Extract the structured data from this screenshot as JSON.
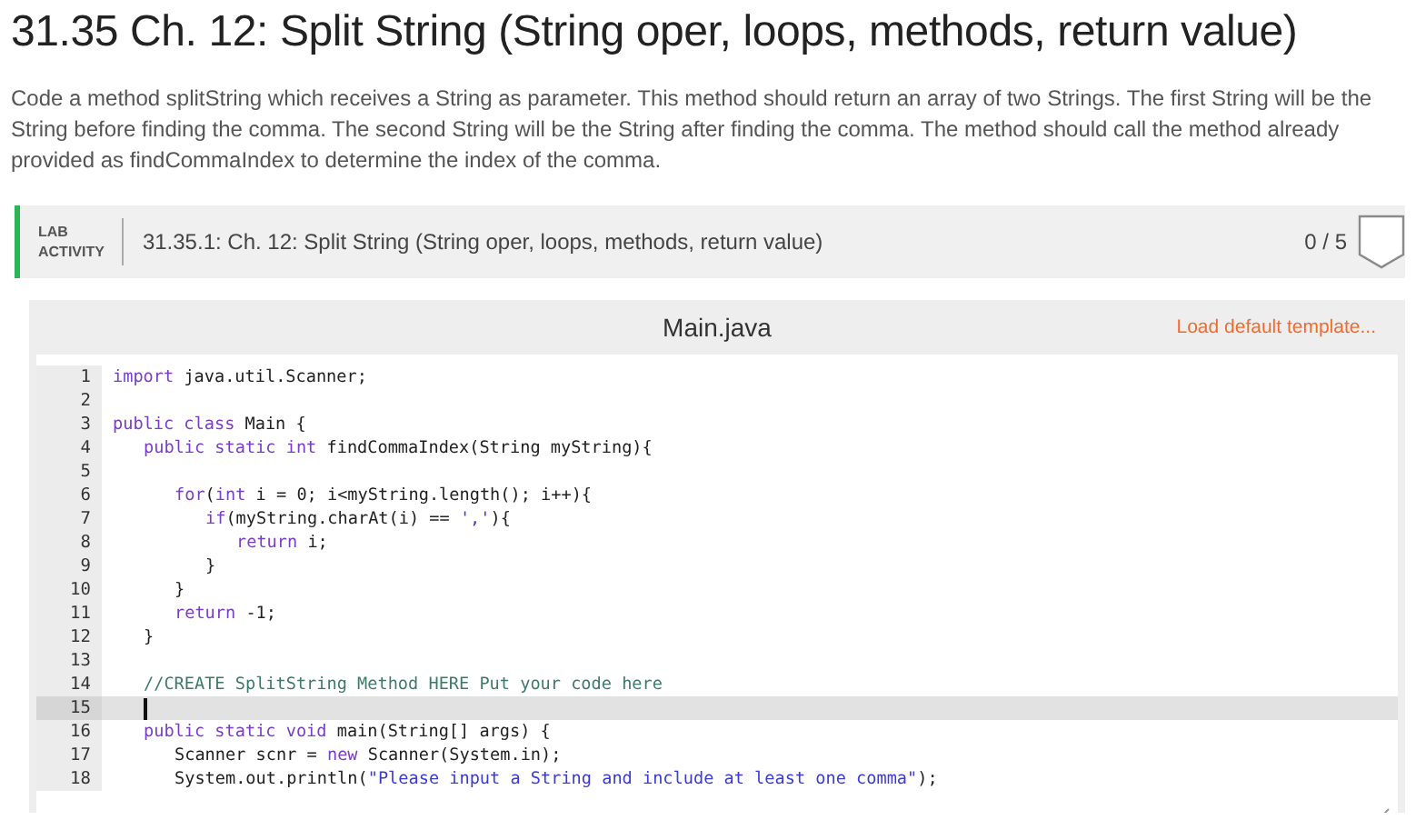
{
  "title": "31.35 Ch. 12: Split String (String oper, loops, methods, return value)",
  "description": "Code a method splitString which receives a String as parameter. This method should return an array of two Strings. The first String will be the String before finding the comma. The second String will be the String after finding the comma. The method should call the method already provided as findCommaIndex to determine the index of the comma.",
  "lab_activity": {
    "badge_line_1": "LAB",
    "badge_line_2": "ACTIVITY",
    "label": "31.35.1: Ch. 12: Split String (String oper, loops, methods, return value)",
    "score": "0 / 5"
  },
  "editor": {
    "file_name": "Main.java",
    "template_link": "Load default template...",
    "lines": [
      {
        "number": "1",
        "active": false,
        "tokens": [
          {
            "kind": "keyword",
            "text": "import"
          },
          {
            "kind": "plain",
            "text": " java.util.Scanner;"
          }
        ]
      },
      {
        "number": "2",
        "active": false
      },
      {
        "number": "3",
        "active": false,
        "tokens": [
          {
            "kind": "keyword",
            "text": "public class"
          },
          {
            "kind": "plain",
            "text": " Main {"
          }
        ],
        "children": [
          {
            "number": "4",
            "active": false,
            "tokens": [
              {
                "kind": "keyword",
                "text": "public static int"
              },
              {
                "kind": "plain",
                "text": " findCommaIndex(String myString){"
              }
            ],
            "children": [
              {
                "number": "5",
                "active": false
              },
              {
                "number": "6",
                "active": false,
                "tokens": [
                  {
                    "kind": "keyword",
                    "text": "for"
                  },
                  {
                    "kind": "plain",
                    "text": "("
                  },
                  {
                    "kind": "keyword",
                    "text": "int"
                  },
                  {
                    "kind": "plain",
                    "text": " i = 0; i<myString.length(); i++){"
                  }
                ],
                "children": [
                  {
                    "number": "7",
                    "active": false,
                    "tokens": [
                      {
                        "kind": "keyword",
                        "text": "if"
                      },
                      {
                        "kind": "plain",
                        "text": "(myString.charAt(i) == "
                      },
                      {
                        "kind": "string",
                        "text": "','"
                      },
                      {
                        "kind": "plain",
                        "text": "){"
                      }
                    ],
                    "children": [
                      {
                        "number": "8",
                        "active": false,
                        "tokens": [
                          {
                            "kind": "keyword",
                            "text": "return"
                          },
                          {
                            "kind": "plain",
                            "text": " i;"
                          }
                        ]
                      }
                    ]
                  },
                  {
                    "number": "9",
                    "active": false,
                    "tokens": [
                      {
                        "kind": "plain",
                        "text": "}"
                      }
                    ]
                  }
                ]
              },
              {
                "number": "10",
                "active": false,
                "tokens": [
                  {
                    "kind": "plain",
                    "text": "}"
                  }
                ]
              },
              {
                "number": "11",
                "active": false,
                "tokens": [
                  {
                    "kind": "keyword",
                    "text": "return"
                  },
                  {
                    "kind": "plain",
                    "text": " -1;"
                  }
                ]
              }
            ]
          },
          {
            "number": "12",
            "active": false,
            "tokens": [
              {
                "kind": "plain",
                "text": "}"
              }
            ]
          },
          {
            "number": "13",
            "active": false
          },
          {
            "number": "14",
            "active": false,
            "tokens": [
              {
                "kind": "comment",
                "text": "//CREATE SplitString Method HERE Put your code here"
              }
            ]
          },
          {
            "number": "15",
            "active": true
          },
          {
            "number": "16",
            "active": false,
            "tokens": [
              {
                "kind": "keyword",
                "text": "public static void"
              },
              {
                "kind": "plain",
                "text": " main(String[] args) {"
              }
            ],
            "children": [
              {
                "number": "17",
                "active": false,
                "tokens": [
                  {
                    "kind": "plain",
                    "text": "Scanner scnr = "
                  },
                  {
                    "kind": "keyword",
                    "text": "new"
                  },
                  {
                    "kind": "plain",
                    "text": " Scanner(System.in);"
                  }
                ]
              },
              {
                "number": "18",
                "active": false,
                "tokens": [
                  {
                    "kind": "plain",
                    "text": "System.out.println("
                  },
                  {
                    "kind": "string",
                    "text": "\"Please input a String and include at least one comma\""
                  },
                  {
                    "kind": "plain",
                    "text": ");"
                  }
                ]
              }
            ]
          }
        ]
      }
    ]
  }
}
